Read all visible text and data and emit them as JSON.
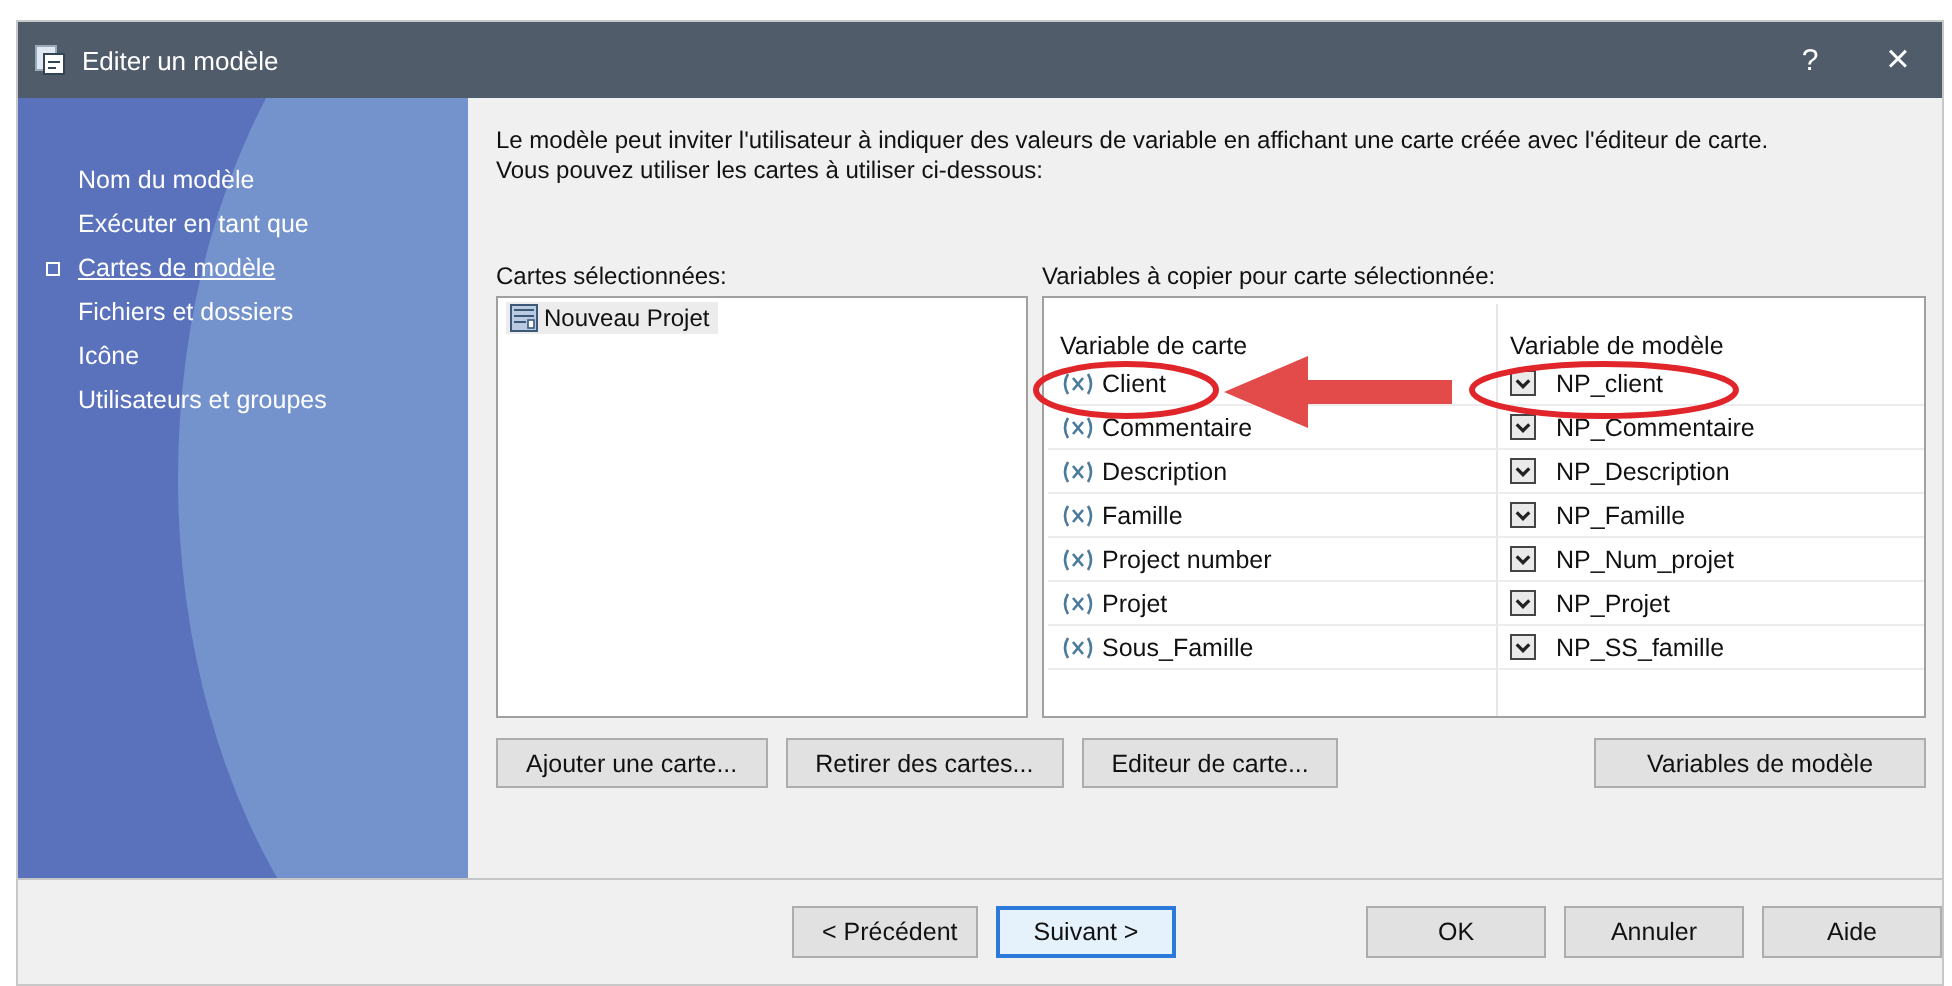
{
  "window": {
    "title": "Editer un modèle",
    "help_button": "?",
    "close_button": "×"
  },
  "sidebar": {
    "items": [
      {
        "label": "Nom du modèle",
        "selected": false
      },
      {
        "label": "Exécuter en tant que",
        "selected": false
      },
      {
        "label": "Cartes de modèle",
        "selected": true
      },
      {
        "label": "Fichiers et dossiers",
        "selected": false
      },
      {
        "label": "Icône",
        "selected": false
      },
      {
        "label": "Utilisateurs et groupes",
        "selected": false
      }
    ]
  },
  "description": [
    "Le modèle peut inviter l'utilisateur à indiquer des valeurs de variable en affichant une carte créée avec l'éditeur de carte.",
    "Vous pouvez utiliser les cartes à utiliser ci-dessous:"
  ],
  "cards": {
    "label": "Cartes sélectionnées:",
    "items": [
      {
        "label": "Nouveau Projet",
        "selected": true
      }
    ]
  },
  "variables": {
    "label": "Variables à copier pour carte sélectionnée:",
    "columns": [
      "Variable de carte",
      "Variable de modèle"
    ],
    "rows": [
      {
        "card_variable": "Client",
        "template_variable": "NP_client",
        "checked": true
      },
      {
        "card_variable": "Commentaire",
        "template_variable": "NP_Commentaire",
        "checked": true
      },
      {
        "card_variable": "Description",
        "template_variable": "NP_Description",
        "checked": true
      },
      {
        "card_variable": "Famille",
        "template_variable": "NP_Famille",
        "checked": true
      },
      {
        "card_variable": "Project number",
        "template_variable": "NP_Num_projet",
        "checked": true
      },
      {
        "card_variable": "Projet",
        "template_variable": "NP_Projet",
        "checked": true
      },
      {
        "card_variable": "Sous_Famille",
        "template_variable": "NP_SS_famille",
        "checked": true
      }
    ]
  },
  "actions": [
    "Ajouter une carte...",
    "Retirer des cartes...",
    "Editeur de carte...",
    "Variables de modèle"
  ],
  "footer": {
    "buttons": [
      {
        "label": "< Précédent",
        "selected": false
      },
      {
        "label": "Suivant >",
        "selected": true
      },
      {
        "label": "OK",
        "selected": false
      },
      {
        "label": "Annuler",
        "selected": false
      },
      {
        "label": "Aide",
        "selected": false
      }
    ]
  }
}
